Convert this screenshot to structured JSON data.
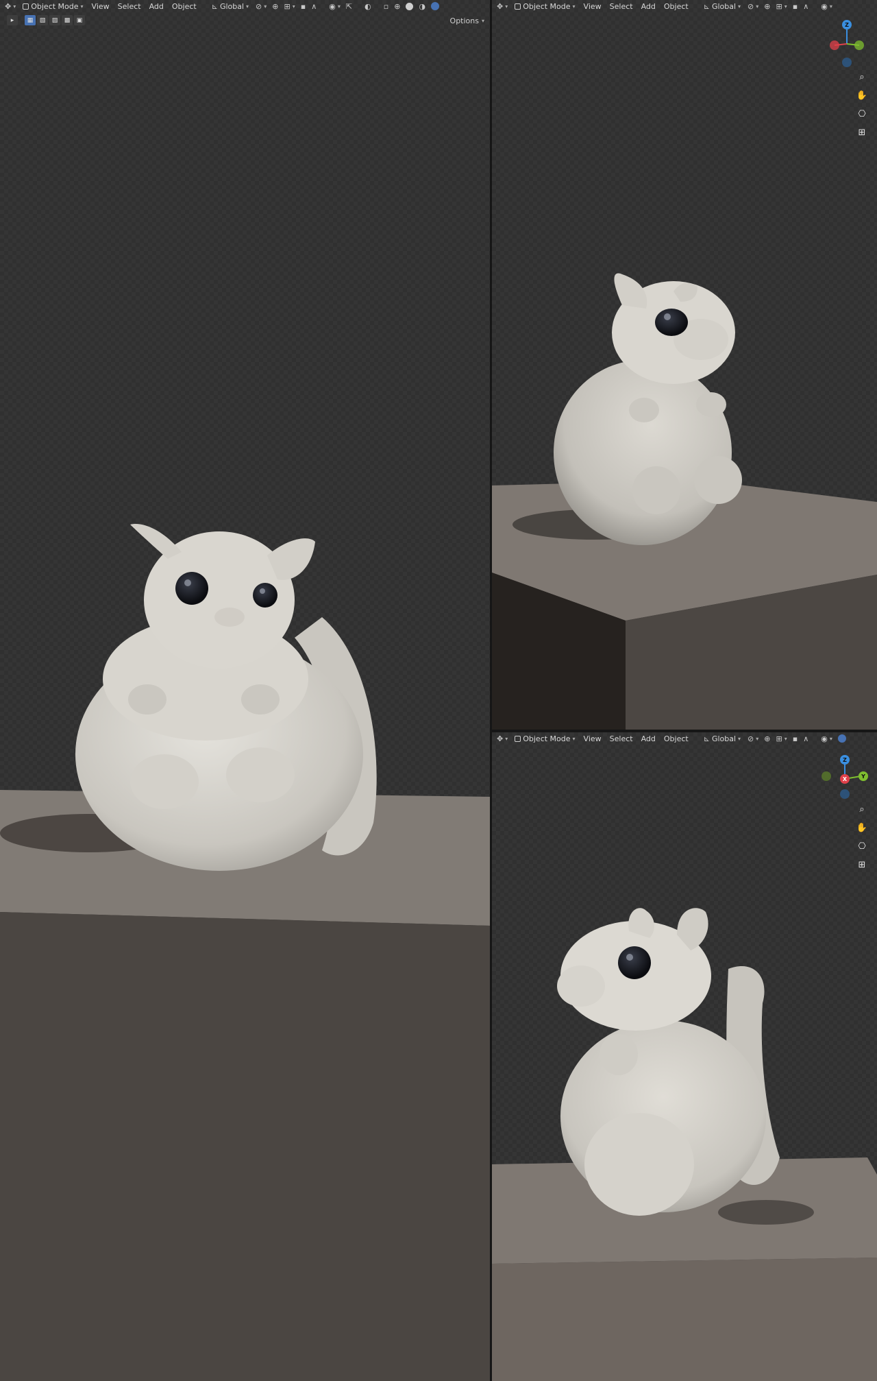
{
  "header": {
    "mode_label": "Object Mode",
    "menus": [
      "View",
      "Select",
      "Add",
      "Object"
    ],
    "orientation_label": "Global"
  },
  "toolbar": {
    "options_label": "Options"
  },
  "gizmo": {
    "top_right": {
      "z": "Z",
      "x": "X",
      "y": "Y"
    },
    "bottom_right": {
      "z": "Z",
      "x": "X",
      "y": "Y"
    }
  },
  "icons": {
    "editor_type": "globe-editor-icon",
    "mode": "object-mode-icon",
    "orientation": "transform-orientation-icon",
    "snap": "snap-magnet-icon",
    "proportional": "proportional-edit-icon",
    "overlays": "overlays-icon",
    "shading": "viewport-shading-icon",
    "zoom": "zoom-icon",
    "pan": "hand-pan-icon",
    "camera": "camera-view-icon",
    "perspective": "perspective-grid-icon"
  },
  "colors": {
    "accent": "#4772b3",
    "axis_x": "#e0404a",
    "axis_y": "#7fbf2f",
    "axis_z": "#3a8fe0",
    "box_top": "#807a74",
    "box_front": "#4a4541",
    "model": "#d7d4cd"
  }
}
